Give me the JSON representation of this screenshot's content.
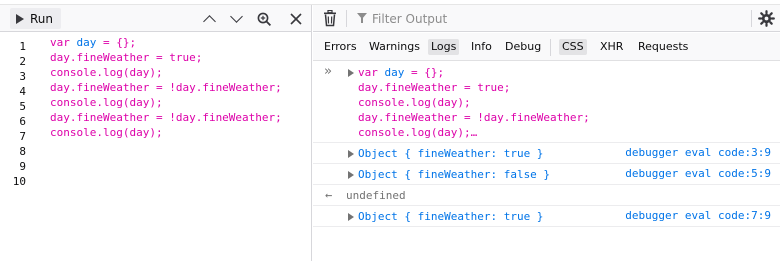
{
  "editor": {
    "run_label": "Run",
    "line_numbers": [
      "1",
      "2",
      "3",
      "4",
      "5",
      "6",
      "7",
      "8",
      "9",
      "10"
    ],
    "code_lines": [
      [
        {
          "t": "kw",
          "v": "var "
        },
        {
          "t": "vr",
          "v": "day"
        },
        {
          "t": "kw",
          "v": " = {};"
        }
      ],
      [
        {
          "t": "kw",
          "v": "day.fineWeather = true;"
        }
      ],
      [
        {
          "t": "kw",
          "v": "console.log(day);"
        }
      ],
      [
        {
          "t": "kw",
          "v": "day.fineWeather = !day.fineWeather;"
        }
      ],
      [
        {
          "t": "kw",
          "v": "console.log(day);"
        }
      ],
      [
        {
          "t": "kw",
          "v": "day.fineWeather = !day.fineWeather;"
        }
      ],
      [
        {
          "t": "kw",
          "v": "console.log(day);"
        }
      ]
    ],
    "icons": [
      "play-icon",
      "chevron-up-icon",
      "chevron-down-icon",
      "search-icon",
      "close-icon"
    ]
  },
  "console": {
    "filter_placeholder": "Filter Output",
    "icons": [
      "trash-icon",
      "filter-icon",
      "gear-icon"
    ],
    "tabs": {
      "errors": "Errors",
      "warnings": "Warnings",
      "logs": "Logs",
      "info": "Info",
      "debug": "Debug",
      "css": "CSS",
      "xhr": "XHR",
      "requests": "Requests"
    },
    "input_echo": {
      "prompt": "»",
      "lines": [
        "var day = {};",
        "day.fineWeather = true;",
        "console.log(day);",
        "day.fineWeather = !day.fineWeather;",
        "console.log(day);…"
      ]
    },
    "messages": [
      {
        "text": "Object { fineWeather: true }",
        "location": "debugger eval code:3:9"
      },
      {
        "text": "Object { fineWeather: false }",
        "location": "debugger eval code:5:9"
      },
      {
        "text": "Object { fineWeather: true }",
        "location": "debugger eval code:7:9"
      }
    ],
    "result": {
      "arrow": "←",
      "value": "undefined"
    }
  },
  "colors": {
    "keyword": "#dd00a9",
    "variable": "#0074e8",
    "object": "#0074e8",
    "toolbar_bg": "#f9f9fa",
    "checked_tab_bg": "#e3e3e5"
  }
}
